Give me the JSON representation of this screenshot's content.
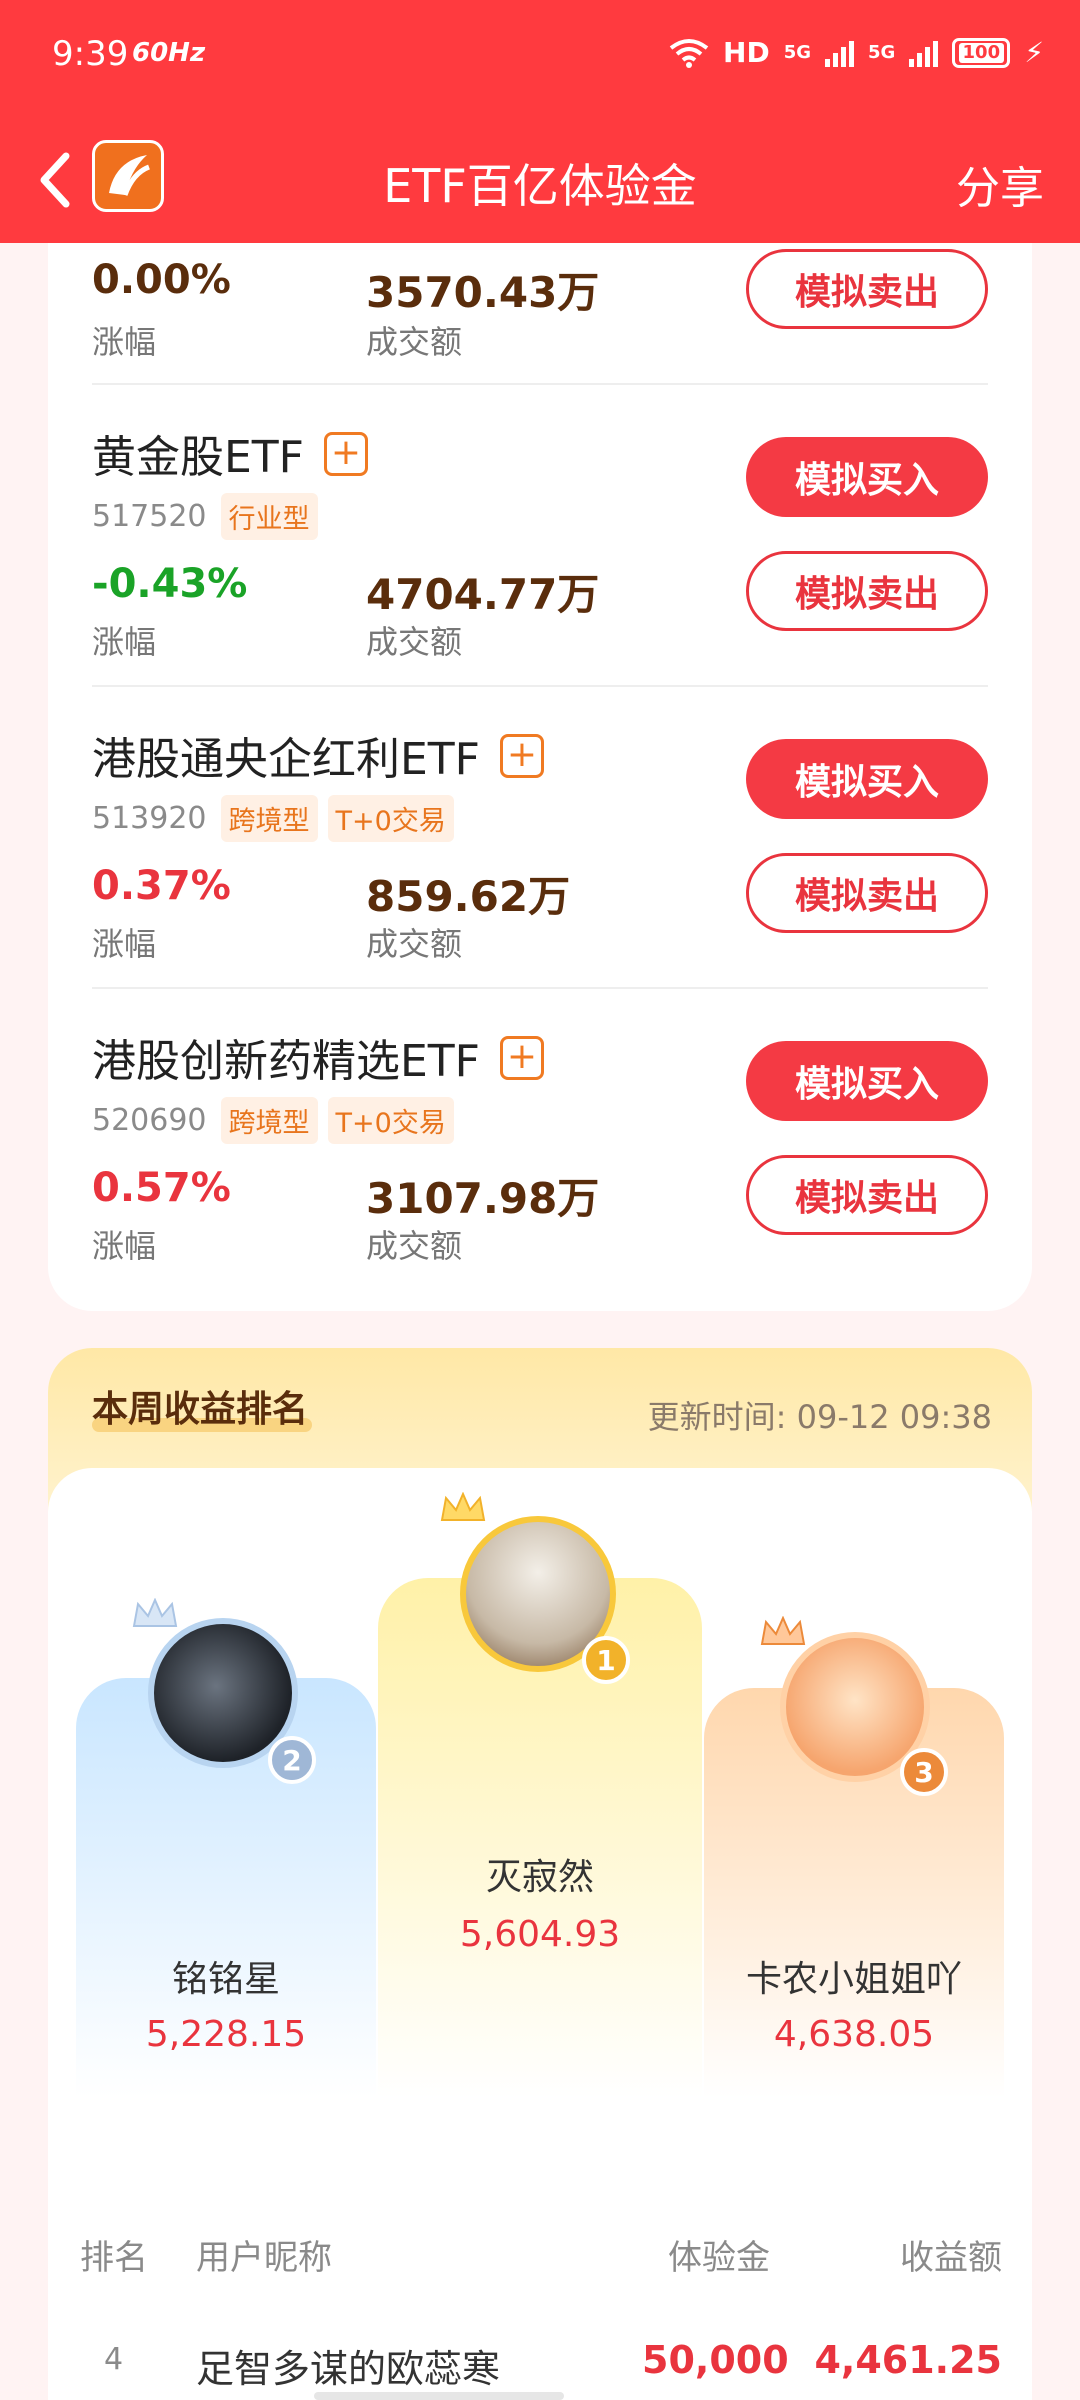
{
  "status_bar": {
    "time": "9:39",
    "refresh": "60Hz",
    "network": "HD",
    "net1": "5G",
    "net2": "5G",
    "battery": "100"
  },
  "header": {
    "title": "ETF百亿体验金",
    "share": "分享"
  },
  "actions": {
    "buy": "模拟买入",
    "sell": "模拟卖出"
  },
  "labels": {
    "change": "涨幅",
    "turnover": "成交额"
  },
  "top_row": {
    "change": "0.00%",
    "turnover": "3570.43万"
  },
  "etfs": [
    {
      "name": "黄金股ETF",
      "code": "517520",
      "tags": [
        "行业型"
      ],
      "change": "-0.43%",
      "turnover": "4704.77万"
    },
    {
      "name": "港股通央企红利ETF",
      "code": "513920",
      "tags": [
        "跨境型",
        "T+0交易"
      ],
      "change": "0.37%",
      "turnover": "859.62万"
    },
    {
      "name": "港股创新药精选ETF",
      "code": "520690",
      "tags": [
        "跨境型",
        "T+0交易"
      ],
      "change": "0.57%",
      "turnover": "3107.98万"
    }
  ],
  "ranking": {
    "title": "本周收益排名",
    "updated": "更新时间: 09-12 09:38",
    "podium": [
      {
        "rank": "1",
        "name": "灭寂然",
        "value": "5,604.93"
      },
      {
        "rank": "2",
        "name": "铭铭星",
        "value": "5,228.15"
      },
      {
        "rank": "3",
        "name": "卡农小姐姐吖",
        "value": "4,638.05"
      }
    ],
    "columns": {
      "rank": "排名",
      "nickname": "用户昵称",
      "fund": "体验金",
      "profit": "收益额"
    },
    "rows": [
      {
        "rank": "4",
        "nickname": "足智多谋的欧蕊寒",
        "fund": "50,000",
        "profit": "4,461.25"
      }
    ]
  },
  "colors": {
    "brand": "#ff3a3f",
    "rise": "#e9343e",
    "fall": "#1aa327",
    "tag": "#e8751d"
  }
}
